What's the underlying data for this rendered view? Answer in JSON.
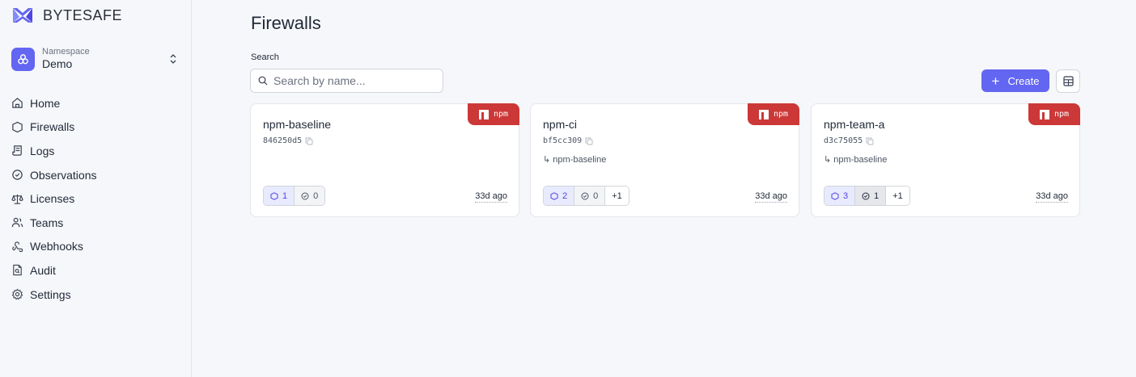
{
  "brand": {
    "name": "BYTESAFE"
  },
  "namespace": {
    "caption": "Namespace",
    "value": "Demo"
  },
  "sidebar": {
    "items": [
      {
        "label": "Home",
        "icon": "home-icon"
      },
      {
        "label": "Firewalls",
        "icon": "shield-icon"
      },
      {
        "label": "Logs",
        "icon": "scroll-icon"
      },
      {
        "label": "Observations",
        "icon": "shield-check-icon"
      },
      {
        "label": "Licenses",
        "icon": "scale-icon"
      },
      {
        "label": "Teams",
        "icon": "users-icon"
      },
      {
        "label": "Webhooks",
        "icon": "webhook-icon"
      },
      {
        "label": "Audit",
        "icon": "file-search-icon"
      },
      {
        "label": "Settings",
        "icon": "gear-icon"
      }
    ]
  },
  "main": {
    "title": "Firewalls",
    "search": {
      "label": "Search",
      "placeholder": "Search by name...",
      "value": ""
    },
    "create_label": "Create"
  },
  "cards": [
    {
      "name": "npm-baseline",
      "id": "846250d5",
      "parent": "",
      "badge": "npm",
      "blocked": "1",
      "approved": "0",
      "extra": "",
      "time": "33d ago"
    },
    {
      "name": "npm-ci",
      "id": "bf5cc309",
      "parent": "↳ npm-baseline",
      "badge": "npm",
      "blocked": "2",
      "approved": "0",
      "extra": "+1",
      "time": "33d ago"
    },
    {
      "name": "npm-team-a",
      "id": "d3c75055",
      "parent": "↳ npm-baseline",
      "badge": "npm",
      "blocked": "3",
      "approved": "1",
      "extra": "+1",
      "time": "33d ago"
    }
  ],
  "colors": {
    "accent": "#6366f1",
    "npm": "#cb3837"
  }
}
